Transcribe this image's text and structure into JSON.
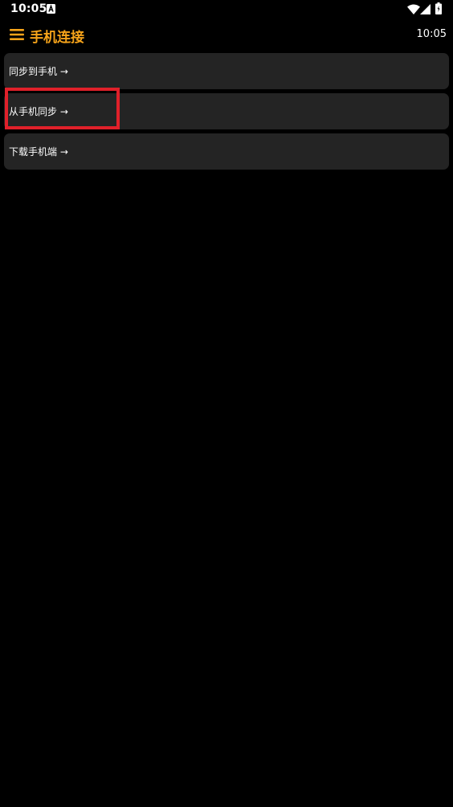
{
  "status_bar": {
    "time": "10:05",
    "icons": [
      "notification-a-icon",
      "wifi-icon",
      "signal-icon",
      "battery-icon"
    ]
  },
  "app_bar": {
    "title": "手机连接",
    "clock": "10:05",
    "menu_icon": "hamburger-menu-icon",
    "title_color": "#f5a31a"
  },
  "menu": {
    "items": [
      {
        "label": "同步到手机 →"
      },
      {
        "label": "从手机同步 →"
      },
      {
        "label": "下载手机端 →"
      }
    ],
    "item_background": "#242424"
  },
  "highlight": {
    "target": "从手机同步 →",
    "color": "#e0202a"
  }
}
